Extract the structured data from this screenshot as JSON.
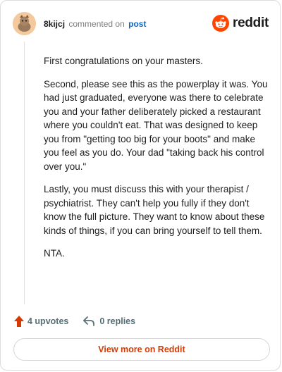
{
  "header": {
    "username": "8kijcj",
    "action_text": "commented on",
    "post_link": "post",
    "brand_name": "reddit"
  },
  "comment": {
    "paragraphs": [
      "First congratulations on your masters.",
      "Second, please see this as the powerplay it was. You had just graduated, everyone was there to celebrate you and your father deliberately picked a restaurant where you couldn't eat. That was designed to keep you from \"getting too big for your boots\" and make you feel as you do. Your dad \"taking back his control over you.\"",
      "Lastly, you must discuss this with your therapist / psychiatrist. They can't help you fully if they don't know the full picture. They want to know about these kinds of things, if you can bring yourself to tell them.",
      "NTA."
    ]
  },
  "footer": {
    "upvotes": "4 upvotes",
    "replies": "0 replies",
    "view_more": "View more on Reddit"
  },
  "colors": {
    "brand": "#ff4500",
    "upvote": "#d93a00",
    "link": "#0a66c2"
  },
  "icons": [
    "user-avatar",
    "reddit-logo-icon",
    "upvote-arrow-icon",
    "reply-arrow-icon"
  ]
}
